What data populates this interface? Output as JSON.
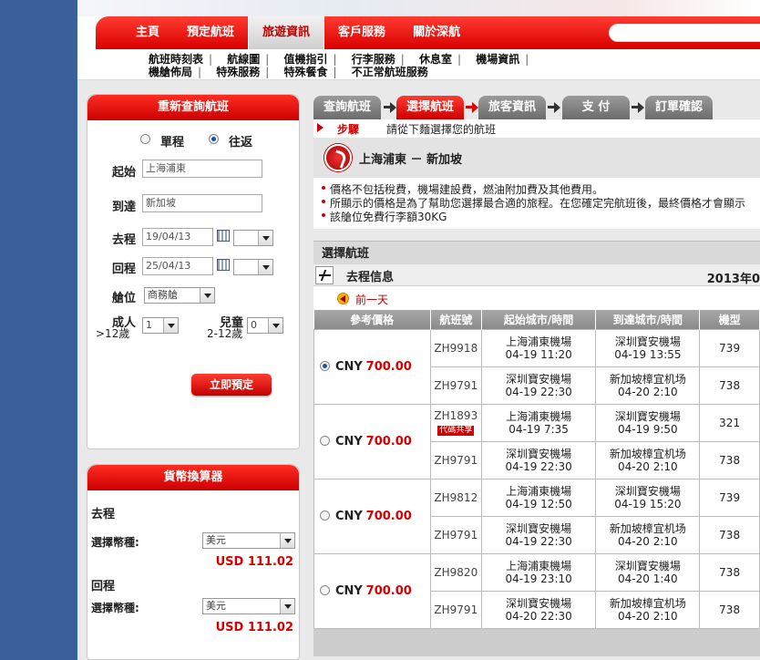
{
  "top_nav": {
    "items": [
      "主頁",
      "預定航班",
      "旅遊資訊",
      "客戶服務",
      "關於深航"
    ],
    "active_index": 2
  },
  "sub_nav": {
    "row1": [
      "航班時刻表",
      "航線圖",
      "值機指引",
      "行李服務",
      "休息室",
      "機場資訊"
    ],
    "row2": [
      "機艙佈局",
      "特殊服務",
      "特殊餐食",
      "不正常航班服務"
    ]
  },
  "search_panel": {
    "title": "重新查詢航班",
    "oneway_label": "單程",
    "roundtrip_label": "往返",
    "trip_type": "roundtrip",
    "from_label": "起始",
    "from_value": "上海浦東",
    "to_label": "到達",
    "to_value": "新加坡",
    "depart_label": "去程",
    "depart_date": "19/04/13",
    "return_label": "回程",
    "return_date": "25/04/13",
    "cabin_label": "艙位",
    "cabin_value": "商務艙",
    "adult_label": "成人",
    "adult_sub": ">12歲",
    "adult_count": "1",
    "child_label": "兒童",
    "child_sub": "2-12歲",
    "child_count": "0",
    "book_button": "立即預定"
  },
  "currency_panel": {
    "title": "貨幣換算器",
    "outbound_label": "去程",
    "select_label_1": "選擇幣種:",
    "currency_1": "美元",
    "amount_1": "USD 111.02",
    "return_label": "回程",
    "select_label_2": "選擇幣種:",
    "currency_2": "美元",
    "amount_2": "USD 111.02"
  },
  "steps": [
    "查詢航班",
    "選擇航班",
    "旅客資訊",
    "支 付",
    "訂單確認"
  ],
  "active_step": 1,
  "step_hint": {
    "label": "步驟",
    "text": "請從下麵選擇您的航班"
  },
  "route": "上海浦東 － 新加坡",
  "notes": [
    "價格不包括稅費，機場建設費，燃油附加費及其他費用。",
    "所顯示的價格是為了幫助您選擇最合適的旅程。在您確定完航班後，最終價格才會顯示",
    "該艙位免費行李額30KG"
  ],
  "choose_header": "選擇航班",
  "outbound_label": "去程信息",
  "outbound_date": "2013年0",
  "prev_day": "前一天",
  "table_headers": [
    "參考價格",
    "航班號",
    "起始城市/時間",
    "到達城市/時間",
    "機型"
  ],
  "options": [
    {
      "selected": true,
      "currency": "CNY",
      "amount": "700.00",
      "legs": [
        {
          "flight": "ZH9918",
          "badge": "",
          "from": "上海浦東機場",
          "dep": "04-19 11:20",
          "to": "深圳寶安機場",
          "arr": "04-19 13:55",
          "model": "739"
        },
        {
          "flight": "ZH9791",
          "badge": "",
          "from": "深圳寶安機場",
          "dep": "04-19 22:30",
          "to": "新加坡樟宜机场",
          "arr": "04-20 2:10",
          "model": "738"
        }
      ]
    },
    {
      "selected": false,
      "currency": "CNY",
      "amount": "700.00",
      "legs": [
        {
          "flight": "ZH1893",
          "badge": "代碼共享",
          "from": "上海浦東機場",
          "dep": "04-19 7:35",
          "to": "深圳寶安機場",
          "arr": "04-19 9:50",
          "model": "321"
        },
        {
          "flight": "ZH9791",
          "badge": "",
          "from": "深圳寶安機場",
          "dep": "04-19 22:30",
          "to": "新加坡樟宜机场",
          "arr": "04-20 2:10",
          "model": "738"
        }
      ]
    },
    {
      "selected": false,
      "currency": "CNY",
      "amount": "700.00",
      "legs": [
        {
          "flight": "ZH9812",
          "badge": "",
          "from": "上海浦東機場",
          "dep": "04-19 12:50",
          "to": "深圳寶安機場",
          "arr": "04-19 15:20",
          "model": "739"
        },
        {
          "flight": "ZH9791",
          "badge": "",
          "from": "深圳寶安機場",
          "dep": "04-19 22:30",
          "to": "新加坡樟宜机场",
          "arr": "04-20 2:10",
          "model": "738"
        }
      ]
    },
    {
      "selected": false,
      "currency": "CNY",
      "amount": "700.00",
      "legs": [
        {
          "flight": "ZH9820",
          "badge": "",
          "from": "上海浦東機場",
          "dep": "04-19 23:10",
          "to": "深圳寶安機場",
          "arr": "04-20 1:40",
          "model": "738"
        },
        {
          "flight": "ZH9791",
          "badge": "",
          "from": "深圳寶安機場",
          "dep": "04-20 22:30",
          "to": "新加坡樟宜机场",
          "arr": "04-20 2:10",
          "model": "738"
        }
      ]
    }
  ],
  "colors": {
    "brand_red": "#d60000",
    "nav_gray": "#8a8a8a",
    "side_blue": "#3b5f9a"
  }
}
